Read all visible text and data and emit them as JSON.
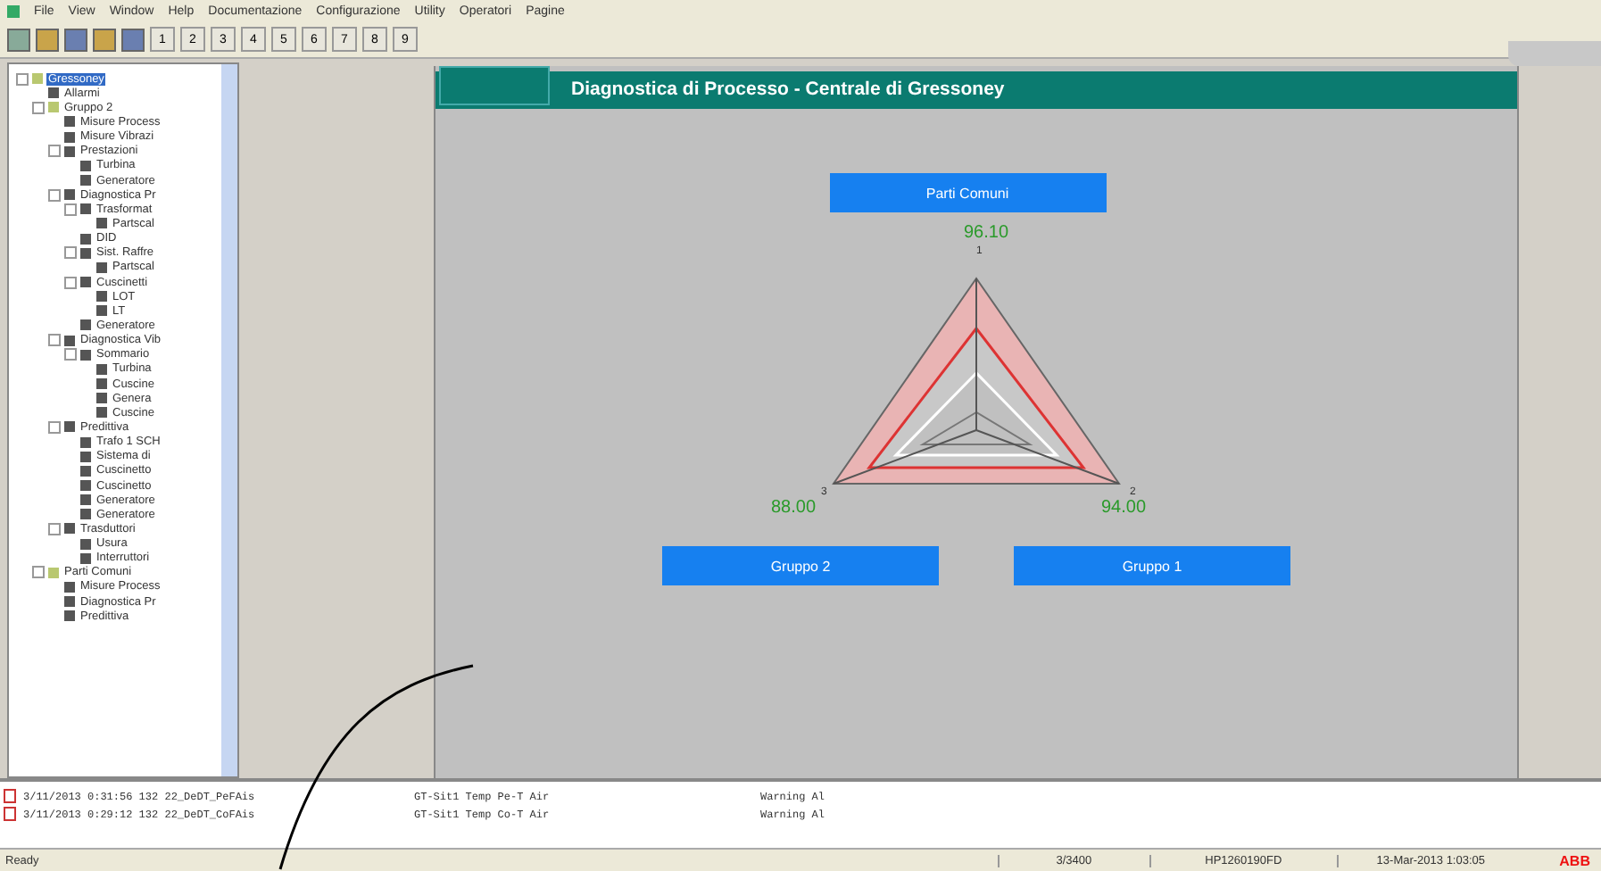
{
  "menu": [
    "File",
    "View",
    "Window",
    "Help",
    "Documentazione",
    "Configurazione",
    "Utility",
    "Operatori",
    "Pagine"
  ],
  "toolbar_buttons": [
    "1",
    "2",
    "3",
    "4",
    "5",
    "6",
    "7",
    "8",
    "9"
  ],
  "tree": [
    {
      "label": "Gressoney",
      "selected": true,
      "children": [
        {
          "label": "Allarmi",
          "selected": false
        },
        {
          "label": "Gruppo 2",
          "selected": false,
          "children": [
            {
              "label": "Misure Process",
              "selected": false
            },
            {
              "label": "Misure Vibrazi",
              "selected": false
            },
            {
              "label": "Prestazioni",
              "selected": false,
              "children": [
                {
                  "label": "Turbina",
                  "selected": false
                },
                {
                  "label": "Generatore",
                  "selected": false
                }
              ]
            },
            {
              "label": "Diagnostica Pr",
              "selected": false,
              "children": [
                {
                  "label": "Trasformat",
                  "selected": false,
                  "children": [
                    {
                      "label": "Partscal",
                      "selected": false
                    }
                  ]
                },
                {
                  "label": "DID",
                  "selected": false
                },
                {
                  "label": "Sist. Raffre",
                  "selected": false,
                  "children": [
                    {
                      "label": "Partscal",
                      "selected": false
                    }
                  ]
                },
                {
                  "label": "Cuscinetti",
                  "selected": false,
                  "children": [
                    {
                      "label": "LOT",
                      "selected": false
                    },
                    {
                      "label": "LT",
                      "selected": false
                    }
                  ]
                },
                {
                  "label": "Generatore",
                  "selected": false
                }
              ]
            },
            {
              "label": "Diagnostica Vib",
              "selected": false,
              "children": [
                {
                  "label": "Sommario",
                  "selected": false,
                  "children": [
                    {
                      "label": "Turbina",
                      "selected": false
                    },
                    {
                      "label": "Cuscine",
                      "selected": false
                    },
                    {
                      "label": "Genera",
                      "selected": false
                    },
                    {
                      "label": "Cuscine",
                      "selected": false
                    }
                  ]
                }
              ]
            },
            {
              "label": "Predittiva",
              "selected": false,
              "children": [
                {
                  "label": "Trafo 1 SCH",
                  "selected": false
                },
                {
                  "label": "Sistema di",
                  "selected": false
                },
                {
                  "label": "Cuscinetto",
                  "selected": false
                },
                {
                  "label": "Cuscinetto",
                  "selected": false
                },
                {
                  "label": "Generatore",
                  "selected": false
                },
                {
                  "label": "Generatore",
                  "selected": false
                }
              ]
            },
            {
              "label": "Trasduttori",
              "selected": false,
              "children": [
                {
                  "label": "Usura",
                  "selected": false
                },
                {
                  "label": "Interruttori",
                  "selected": false
                }
              ]
            }
          ]
        },
        {
          "label": "Parti Comuni",
          "selected": false,
          "children": [
            {
              "label": "Misure Process",
              "selected": false
            },
            {
              "label": "Diagnostica Pr",
              "selected": false
            },
            {
              "label": "Predittiva",
              "selected": false
            }
          ]
        }
      ]
    }
  ],
  "panel": {
    "title": "Diagnostica di Processo - Centrale di Gressoney",
    "top_button": "Parti Comuni",
    "left_button": "Gruppo 2",
    "right_button": "Gruppo 1",
    "radar": {
      "top_axis": "1",
      "left_axis": "3",
      "right_axis": "2",
      "top_value": "96.10",
      "left_value": "88.00",
      "right_value": "94.00"
    }
  },
  "log": [
    {
      "text": "3/11/2013 0:31:56 132 22_DeDT_PeFAis",
      "source": "GT-Sit1  Temp  Pe-T  Air",
      "level": "Warning Al"
    },
    {
      "text": "3/11/2013 0:29:12 132 22_DeDT_CoFAis",
      "source": "GT-Sit1  Temp  Co-T  Air",
      "level": "Warning Al"
    }
  ],
  "status_bar": {
    "state": "Ready",
    "count": "3/3400",
    "host": "HP1260190FD",
    "datetime": "13-Mar-2013 1:03:05",
    "logo": "ABB"
  }
}
